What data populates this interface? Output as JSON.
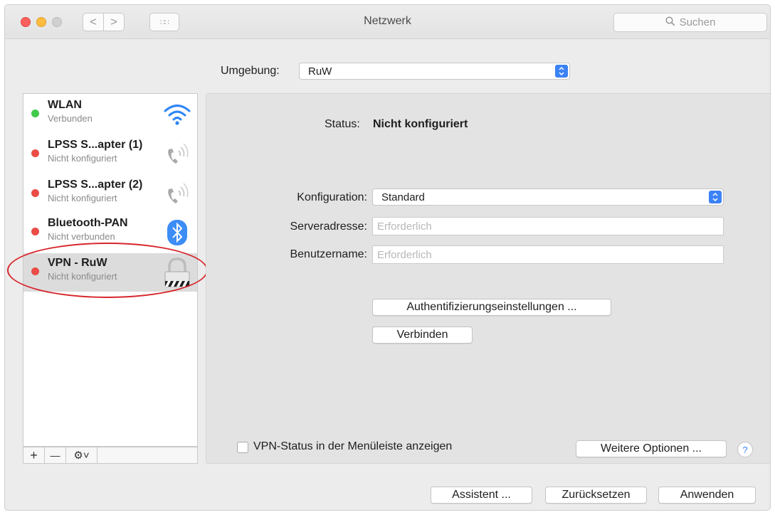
{
  "window": {
    "title": "Netzwerk",
    "search_placeholder": "Suchen",
    "nav_back": "<",
    "nav_forward": ">",
    "grid_glyph": "∷∷"
  },
  "location": {
    "label": "Umgebung:",
    "value": "RuW"
  },
  "services": [
    {
      "name": "WLAN",
      "status": "Verbunden",
      "state": "green",
      "icon": "wifi-icon"
    },
    {
      "name": "LPSS S...apter (1)",
      "status": "Nicht konfiguriert",
      "state": "red",
      "icon": "phone-icon"
    },
    {
      "name": "LPSS S...apter (2)",
      "status": "Nicht konfiguriert",
      "state": "red",
      "icon": "phone-icon"
    },
    {
      "name": "Bluetooth-PAN",
      "status": "Nicht verbunden",
      "state": "red",
      "icon": "bluetooth-icon"
    },
    {
      "name": "VPN - RuW",
      "status": "Nicht konfiguriert",
      "state": "red",
      "icon": "vpn-lock-icon",
      "selected": true
    }
  ],
  "sidebar_toolbar": {
    "add": "+",
    "remove": "—",
    "action": "⚙˅"
  },
  "detail": {
    "status_label": "Status:",
    "status_value": "Nicht konfiguriert",
    "configuration_label": "Konfiguration:",
    "configuration_value": "Standard",
    "server_label": "Serveradresse:",
    "server_placeholder": "Erforderlich",
    "user_label": "Benutzername:",
    "user_placeholder": "Erforderlich",
    "auth_button": "Authentifizierungseinstellungen ...",
    "connect_button": "Verbinden",
    "menubar_checkbox_label": "VPN-Status in der Menüleiste anzeigen",
    "menubar_checkbox_checked": false,
    "more_options_button": "Weitere Optionen ...",
    "help_glyph": "?"
  },
  "footer": {
    "assistant_button": "Assistent ...",
    "revert_button": "Zurücksetzen",
    "apply_button": "Anwenden"
  },
  "colors": {
    "status_connected": "#40c94b",
    "status_off": "#ea4c46",
    "accent": "#3b82f6",
    "annotation": "#d7262c"
  }
}
